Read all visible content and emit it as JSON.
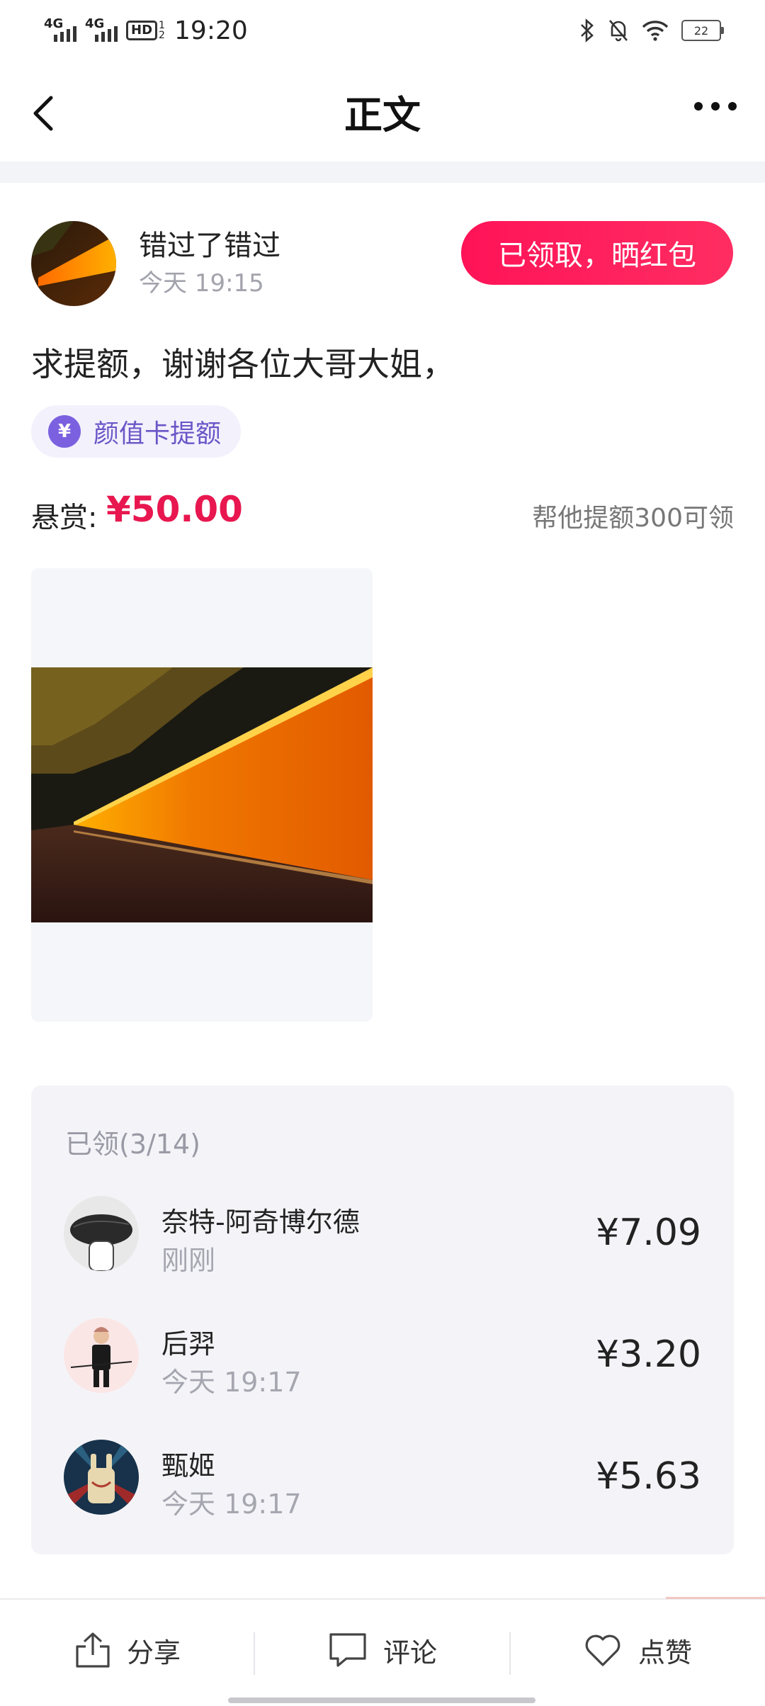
{
  "status_bar": {
    "net1": "4G",
    "net2": "4G",
    "hd": "HD",
    "hd_sub": "1 2",
    "time": "19:20",
    "battery": "22"
  },
  "nav": {
    "title": "正文"
  },
  "post": {
    "author_name": "错过了错过",
    "time": "今天 19:15",
    "claim_button": "已领取，晒红包",
    "text": "求提额，谢谢各位大哥大姐，",
    "tag_symbol": "¥",
    "tag_label": "颜值卡提额",
    "reward_label": "悬赏:",
    "reward_amount": "¥50.00",
    "reward_hint": "帮他提额300可领"
  },
  "claimed": {
    "title": "已领(3/14)",
    "rows": [
      {
        "name": "奈特-阿奇博尔德",
        "time": "刚刚",
        "amount": "¥7.09"
      },
      {
        "name": "后羿",
        "time": "今天 19:17",
        "amount": "¥3.20"
      },
      {
        "name": "甄姬",
        "time": "今天 19:17",
        "amount": "¥5.63"
      }
    ]
  },
  "bottom_bar": {
    "share": "分享",
    "comment": "评论",
    "like": "点赞"
  },
  "colors": {
    "accent": "#ff1a5a",
    "reward": "#e8174f",
    "tag_bg": "#f3f1fc",
    "tag_text": "#6a56c7"
  }
}
